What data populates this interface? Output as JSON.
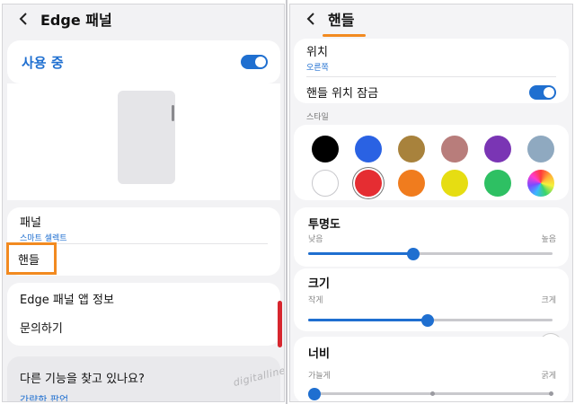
{
  "left": {
    "header": {
      "title": "Edge 패널"
    },
    "use_toggle": {
      "label": "사용 중",
      "state": "on"
    },
    "settings": {
      "panel_title": "패널",
      "panel_sub": "스마트 셀렉트",
      "handle_label": "핸들"
    },
    "info": {
      "about": "Edge 패널 앱 정보",
      "contact": "문의하기"
    },
    "find": {
      "title": "다른 기능을 찾고 있나요?",
      "link": "간략한 팝업"
    },
    "watermark": "digitalline"
  },
  "right": {
    "header": {
      "title": "핸들"
    },
    "position": {
      "title": "위치",
      "value": "오른쪽"
    },
    "lock": {
      "label": "핸들 위치 잠금",
      "state": "on"
    },
    "style": {
      "label": "스타일",
      "colors": [
        "#000000",
        "#2a62e3",
        "#a8823c",
        "#b87d7b",
        "#7a35b4",
        "#8fa9c0",
        "#ffffff",
        "#e52d32",
        "#f07c1e",
        "#e6dd12",
        "#2ec063",
        "rainbow"
      ],
      "selected_index": 7
    },
    "transparency": {
      "title": "투명도",
      "min": "낮음",
      "max": "높음",
      "value": 0.43
    },
    "size": {
      "title": "크기",
      "min": "작게",
      "max": "크게",
      "value": 0.49
    },
    "width": {
      "title": "너비",
      "min": "가늘게",
      "max": "굵게",
      "value": 0.0
    }
  },
  "colors": {
    "accent": "#1f6fd0",
    "highlight": "#f28a20",
    "scroll": "#d7262e"
  }
}
